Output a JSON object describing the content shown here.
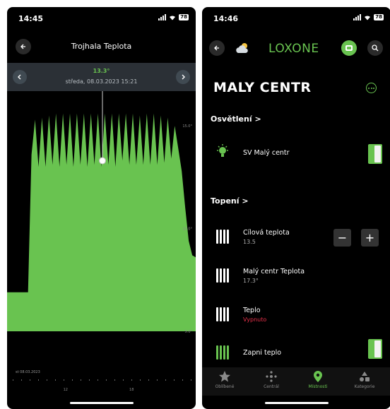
{
  "left": {
    "status": {
      "time": "14:45",
      "battery": "78"
    },
    "title": "Trojhala Teplota",
    "value": "13.3°",
    "date": "středa, 08.03.2023 15:21",
    "y_ticks": [
      "15.0°",
      "10.0°",
      "5.0°"
    ],
    "start_date": "st 08.03.2023",
    "x_ticks": [
      "12",
      "18"
    ],
    "accent": "#69c350"
  },
  "chart_data": {
    "type": "area",
    "ylabel": "",
    "xlabel": "",
    "y_ticks": [
      "15.0°",
      "10.0°",
      "5.0°"
    ],
    "x_ticks": [
      "12",
      "18"
    ],
    "ylim": [
      5,
      16
    ],
    "color": "#69c350",
    "selected": {
      "label": "13.3°"
    },
    "series": [
      {
        "values": [
          6.9,
          6.9,
          6.9,
          6.9,
          6.9,
          6.9,
          6.9,
          13.6,
          15.3,
          13.0,
          15.4,
          13.0,
          15.5,
          13.1,
          15.6,
          13.0,
          15.6,
          13.1,
          15.6,
          13.0,
          15.6,
          13.1,
          15.6,
          13.0,
          15.6,
          13.1,
          15.6,
          13.0,
          15.6,
          13.1,
          15.6,
          13.0,
          15.6,
          13.3,
          15.6,
          13.1,
          15.6,
          13.1,
          15.5,
          13.1,
          15.6,
          13.1,
          15.6,
          13.1,
          15.5,
          13.2,
          15.4,
          13.4,
          15.0,
          13.9,
          12.8,
          11.0,
          9.4,
          8.7,
          8.6
        ]
      }
    ]
  },
  "right": {
    "status": {
      "time": "14:46",
      "battery": "78"
    },
    "brand": "LOXONE",
    "room": "MALY CENTR",
    "section_lights": "Osvětlení >",
    "section_heating": "Topení >",
    "light_name": "SV Malý centr",
    "target_name": "Cílová teplota",
    "target_value": "13.5",
    "temp_name": "Malý centr Teplota",
    "temp_value": "17.3°",
    "heat_name": "Teplo",
    "heat_state": "Vypnuto",
    "switch_name": "Zapni teplo",
    "stepper_minus": "−",
    "stepper_plus": "+",
    "tabs": [
      "Oblíbené",
      "Centrál",
      "Místnosti",
      "Kategorie"
    ],
    "accent": "#69c350",
    "alert": "#e8304a"
  }
}
